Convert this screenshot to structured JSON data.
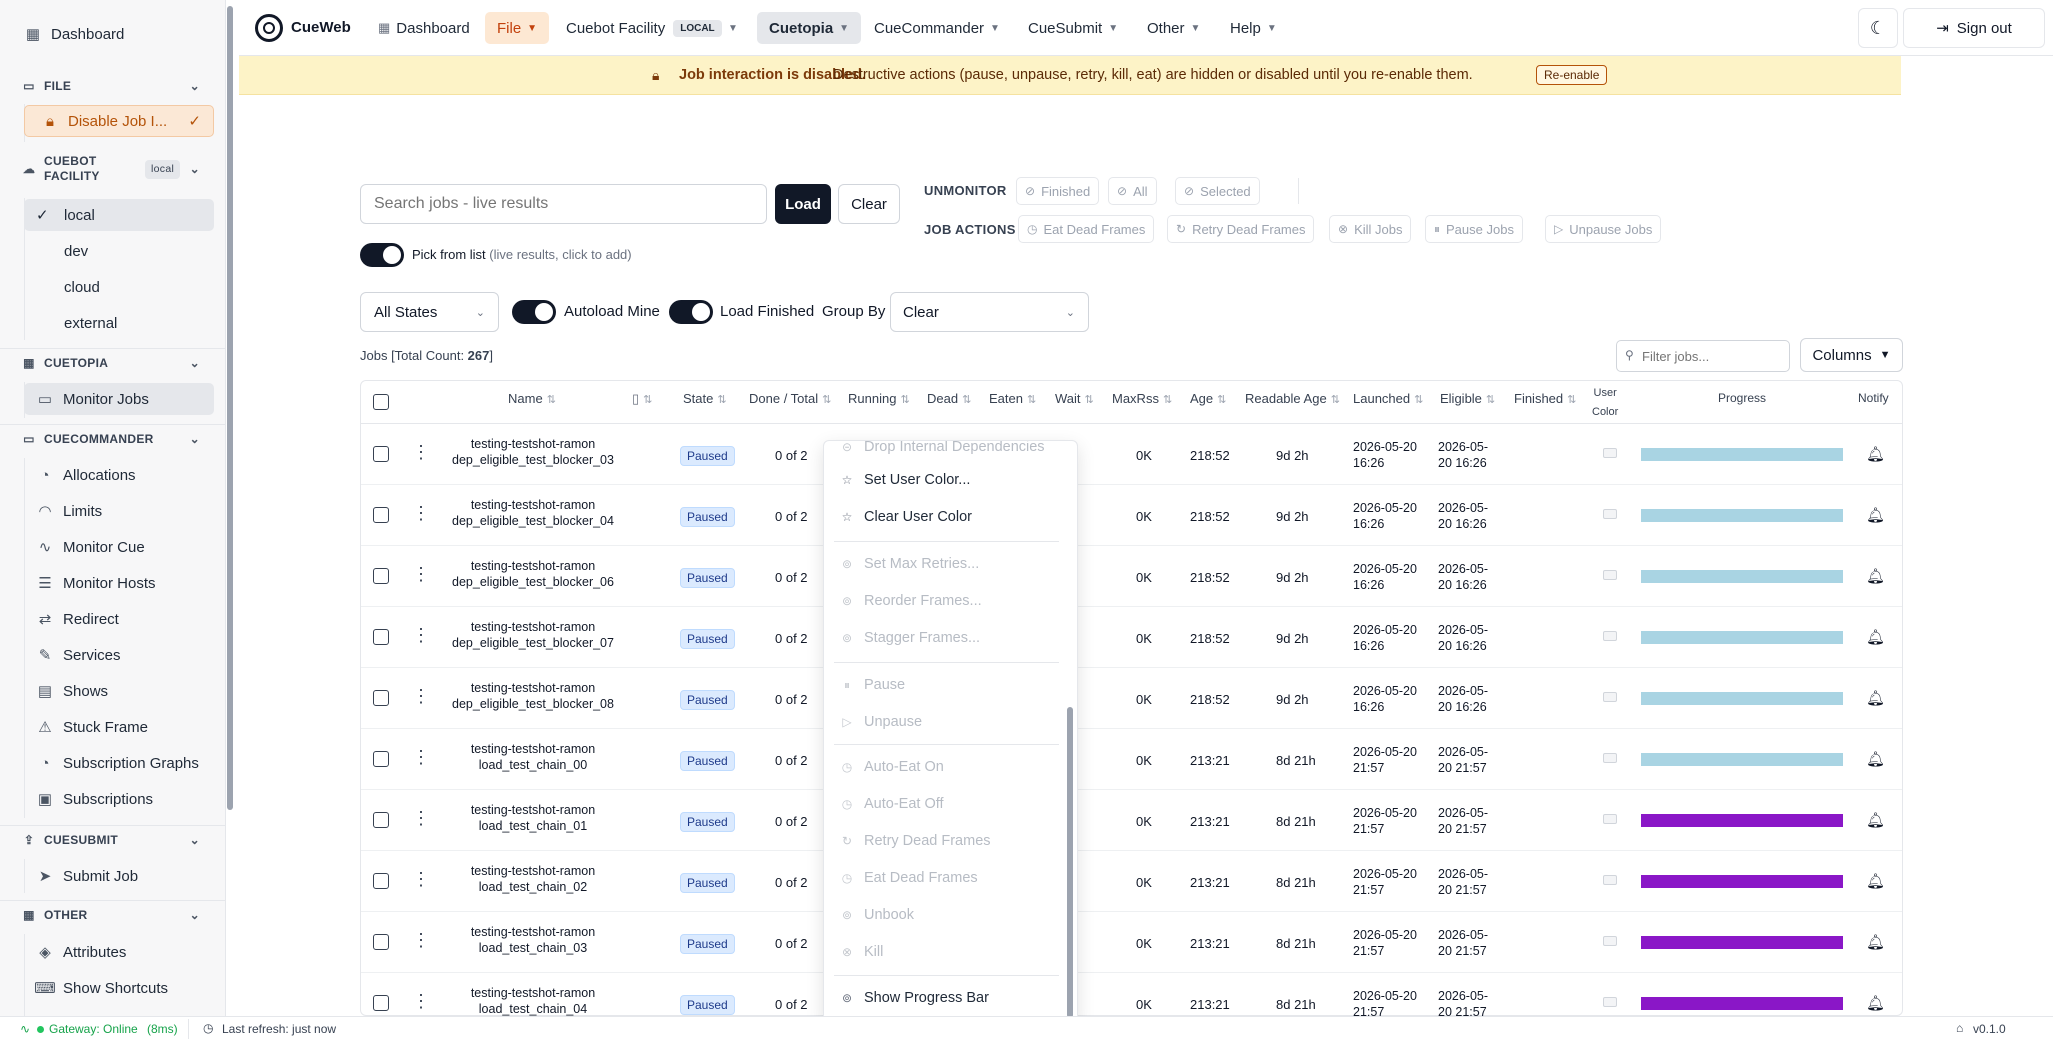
{
  "app": {
    "name": "CueWeb"
  },
  "nav": {
    "dashboard": "Dashboard",
    "file": "File",
    "facility": "Cuebot Facility",
    "facility_badge": "LOCAL",
    "cuetopia": "Cuetopia",
    "cuecommander": "CueCommander",
    "cuesubmit": "CueSubmit",
    "other": "Other",
    "help": "Help",
    "signout": "Sign out"
  },
  "sidebar": {
    "dashboard": "Dashboard",
    "file_header": "FILE",
    "disable_job": "Disable Job I...",
    "facility_header_1": "CUEBOT",
    "facility_header_2": "FACILITY",
    "facility_badge": "local",
    "facilities": [
      "local",
      "dev",
      "cloud",
      "external"
    ],
    "cuetopia_header": "CUETOPIA",
    "monitor_jobs": "Monitor Jobs",
    "cuecommander_header": "CUECOMMANDER",
    "commander_items": [
      "Allocations",
      "Limits",
      "Monitor Cue",
      "Monitor Hosts",
      "Redirect",
      "Services",
      "Shows",
      "Stuck Frame",
      "Subscription Graphs",
      "Subscriptions"
    ],
    "cuesubmit_header": "CUESUBMIT",
    "submit_job": "Submit Job",
    "other_header": "OTHER",
    "other_items": [
      "Attributes",
      "Show Shortcuts"
    ]
  },
  "banner": {
    "title": "Job interaction is disabled.",
    "text": "Destructive actions (pause, unpause, retry, kill, eat) are hidden or disabled until you re-enable them.",
    "button": "Re-enable"
  },
  "search": {
    "placeholder": "Search jobs - live results",
    "load": "Load",
    "clear": "Clear",
    "pick_label": "Pick from list",
    "pick_hint": "(live results, click to add)"
  },
  "unmonitor": {
    "label": "UNMONITOR",
    "finished": "Finished",
    "all": "All",
    "selected": "Selected"
  },
  "job_actions": {
    "label": "JOB ACTIONS",
    "eat": "Eat Dead Frames",
    "retry": "Retry Dead Frames",
    "kill": "Kill Jobs",
    "pause": "Pause Jobs",
    "unpause": "Unpause Jobs"
  },
  "filters": {
    "state": "All States",
    "autoload": "Autoload Mine",
    "load_finished": "Load Finished",
    "group_by_label": "Group By",
    "group_by": "Clear"
  },
  "count": {
    "prefix": "Jobs [Total Count: ",
    "value": "267",
    "suffix": "]"
  },
  "filter_jobs": {
    "placeholder": "Filter jobs...",
    "columns": "Columns"
  },
  "table": {
    "headers": {
      "name": "Name",
      "state": "State",
      "done": "Done / Total",
      "running": "Running",
      "dead": "Dead",
      "eaten": "Eaten",
      "wait": "Wait",
      "maxrss": "MaxRss",
      "age": "Age",
      "readable_age": "Readable Age",
      "launched": "Launched",
      "eligible": "Eligible",
      "finished": "Finished",
      "user_color_1": "User",
      "user_color_2": "Color",
      "progress": "Progress",
      "notify": "Notify"
    },
    "rows": [
      {
        "name1": "testing-testshot-ramon",
        "name2": "dep_eligible_test_blocker_03",
        "state": "Paused",
        "done": "0 of 2",
        "maxrss": "0K",
        "age": "218:52",
        "readable": "9d 2h",
        "launched1": "2026-05-20",
        "launched2": "16:26",
        "eligible1": "2026-05-",
        "eligible2": "20 16:26",
        "progress_color": "#a9d4e3"
      },
      {
        "name1": "testing-testshot-ramon",
        "name2": "dep_eligible_test_blocker_04",
        "state": "Paused",
        "done": "0 of 2",
        "maxrss": "0K",
        "age": "218:52",
        "readable": "9d 2h",
        "launched1": "2026-05-20",
        "launched2": "16:26",
        "eligible1": "2026-05-",
        "eligible2": "20 16:26",
        "progress_color": "#a9d4e3"
      },
      {
        "name1": "testing-testshot-ramon",
        "name2": "dep_eligible_test_blocker_06",
        "state": "Paused",
        "done": "0 of 2",
        "maxrss": "0K",
        "age": "218:52",
        "readable": "9d 2h",
        "launched1": "2026-05-20",
        "launched2": "16:26",
        "eligible1": "2026-05-",
        "eligible2": "20 16:26",
        "progress_color": "#a9d4e3"
      },
      {
        "name1": "testing-testshot-ramon",
        "name2": "dep_eligible_test_blocker_07",
        "state": "Paused",
        "done": "0 of 2",
        "maxrss": "0K",
        "age": "218:52",
        "readable": "9d 2h",
        "launched1": "2026-05-20",
        "launched2": "16:26",
        "eligible1": "2026-05-",
        "eligible2": "20 16:26",
        "progress_color": "#a9d4e3"
      },
      {
        "name1": "testing-testshot-ramon",
        "name2": "dep_eligible_test_blocker_08",
        "state": "Paused",
        "done": "0 of 2",
        "maxrss": "0K",
        "age": "218:52",
        "readable": "9d 2h",
        "launched1": "2026-05-20",
        "launched2": "16:26",
        "eligible1": "2026-05-",
        "eligible2": "20 16:26",
        "progress_color": "#a9d4e3"
      },
      {
        "name1": "testing-testshot-ramon",
        "name2": "load_test_chain_00",
        "state": "Paused",
        "done": "0 of 2",
        "maxrss": "0K",
        "age": "213:21",
        "readable": "8d 21h",
        "launched1": "2026-05-20",
        "launched2": "21:57",
        "eligible1": "2026-05-",
        "eligible2": "20 21:57",
        "progress_color": "#a9d4e3"
      },
      {
        "name1": "testing-testshot-ramon",
        "name2": "load_test_chain_01",
        "state": "Paused",
        "done": "0 of 2",
        "maxrss": "0K",
        "age": "213:21",
        "readable": "8d 21h",
        "launched1": "2026-05-20",
        "launched2": "21:57",
        "eligible1": "2026-05-",
        "eligible2": "20 21:57",
        "progress_color": "#8a17c7"
      },
      {
        "name1": "testing-testshot-ramon",
        "name2": "load_test_chain_02",
        "state": "Paused",
        "done": "0 of 2",
        "maxrss": "0K",
        "age": "213:21",
        "readable": "8d 21h",
        "launched1": "2026-05-20",
        "launched2": "21:57",
        "eligible1": "2026-05-",
        "eligible2": "20 21:57",
        "progress_color": "#8a17c7"
      },
      {
        "name1": "testing-testshot-ramon",
        "name2": "load_test_chain_03",
        "state": "Paused",
        "done": "0 of 2",
        "maxrss": "0K",
        "age": "213:21",
        "readable": "8d 21h",
        "launched1": "2026-05-20",
        "launched2": "21:57",
        "eligible1": "2026-05-",
        "eligible2": "20 21:57",
        "progress_color": "#8a17c7"
      },
      {
        "name1": "testing-testshot-ramon",
        "name2": "load_test_chain_04",
        "state": "Paused",
        "done": "0 of 2",
        "maxrss": "0K",
        "age": "213:21",
        "readable": "8d 21h",
        "launched1": "2026-05-20",
        "launched2": "21:57",
        "eligible1": "2026-05-",
        "eligible2": "20 21:57",
        "progress_color": "#8a17c7"
      }
    ]
  },
  "context_menu": {
    "drop_deps": "Drop Internal Dependencies",
    "set_color": "Set User Color...",
    "clear_color": "Clear User Color",
    "max_retries": "Set Max Retries...",
    "reorder": "Reorder Frames...",
    "stagger": "Stagger Frames...",
    "pause": "Pause",
    "unpause": "Unpause",
    "autoeat_on": "Auto-Eat On",
    "autoeat_off": "Auto-Eat Off",
    "retry_dead": "Retry Dead Frames",
    "eat_dead": "Eat Dead Frames",
    "unbook": "Unbook",
    "kill": "Kill",
    "show_progress": "Show Progress Bar"
  },
  "footer": {
    "gateway": "Gateway: Online",
    "latency": "(8ms)",
    "refresh": "Last refresh: just now",
    "version": "v0.1.0"
  }
}
